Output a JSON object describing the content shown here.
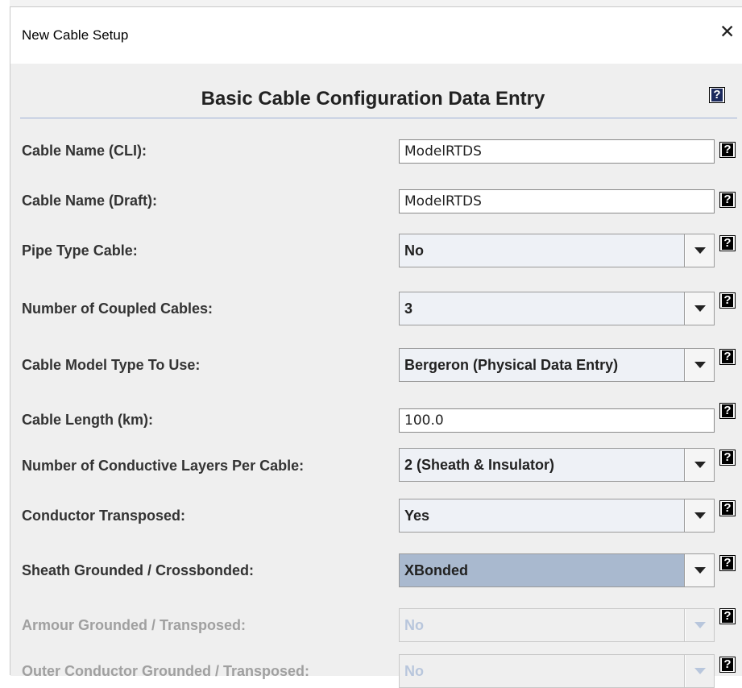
{
  "window": {
    "title": "New Cable Setup",
    "close_glyph": "✕"
  },
  "header": {
    "title": "Basic Cable Configuration Data Entry",
    "help_glyph": "?"
  },
  "rows": [
    {
      "label": "Cable Name (CLI):",
      "type": "text",
      "value": "ModelRTDS"
    },
    {
      "label": "Cable Name (Draft):",
      "type": "text",
      "value": "ModelRTDS"
    },
    {
      "label": "Pipe Type Cable:",
      "type": "select",
      "value": "No"
    },
    {
      "label": "Number of Coupled Cables:",
      "type": "select",
      "value": "3"
    },
    {
      "label": "Cable Model Type To Use:",
      "type": "select",
      "value": "Bergeron (Physical Data Entry)"
    },
    {
      "label": "Cable Length (km):",
      "type": "text",
      "value": "100.0"
    },
    {
      "label": "Number of Conductive Layers Per Cable:",
      "type": "select",
      "value": "2 (Sheath & Insulator)"
    },
    {
      "label": "Conductor Transposed:",
      "type": "select",
      "value": "Yes"
    },
    {
      "label": "Sheath Grounded / Crossbonded:",
      "type": "select",
      "value": "XBonded",
      "state": "selected"
    },
    {
      "label": "Armour Grounded / Transposed:",
      "type": "select",
      "value": "No",
      "state": "disabled"
    },
    {
      "label": "Outer Conductor Grounded / Transposed:",
      "type": "select",
      "value": "No",
      "state": "disabled"
    }
  ],
  "icons": {
    "help": "help-icon",
    "dropdown": "chevron-down-icon",
    "close": "close-icon"
  },
  "colors": {
    "panel_bg": "#efefef",
    "selected_combo": "#a9b9cf",
    "divider": "#9db0d6",
    "disabled_text": "#a0a0a0"
  }
}
